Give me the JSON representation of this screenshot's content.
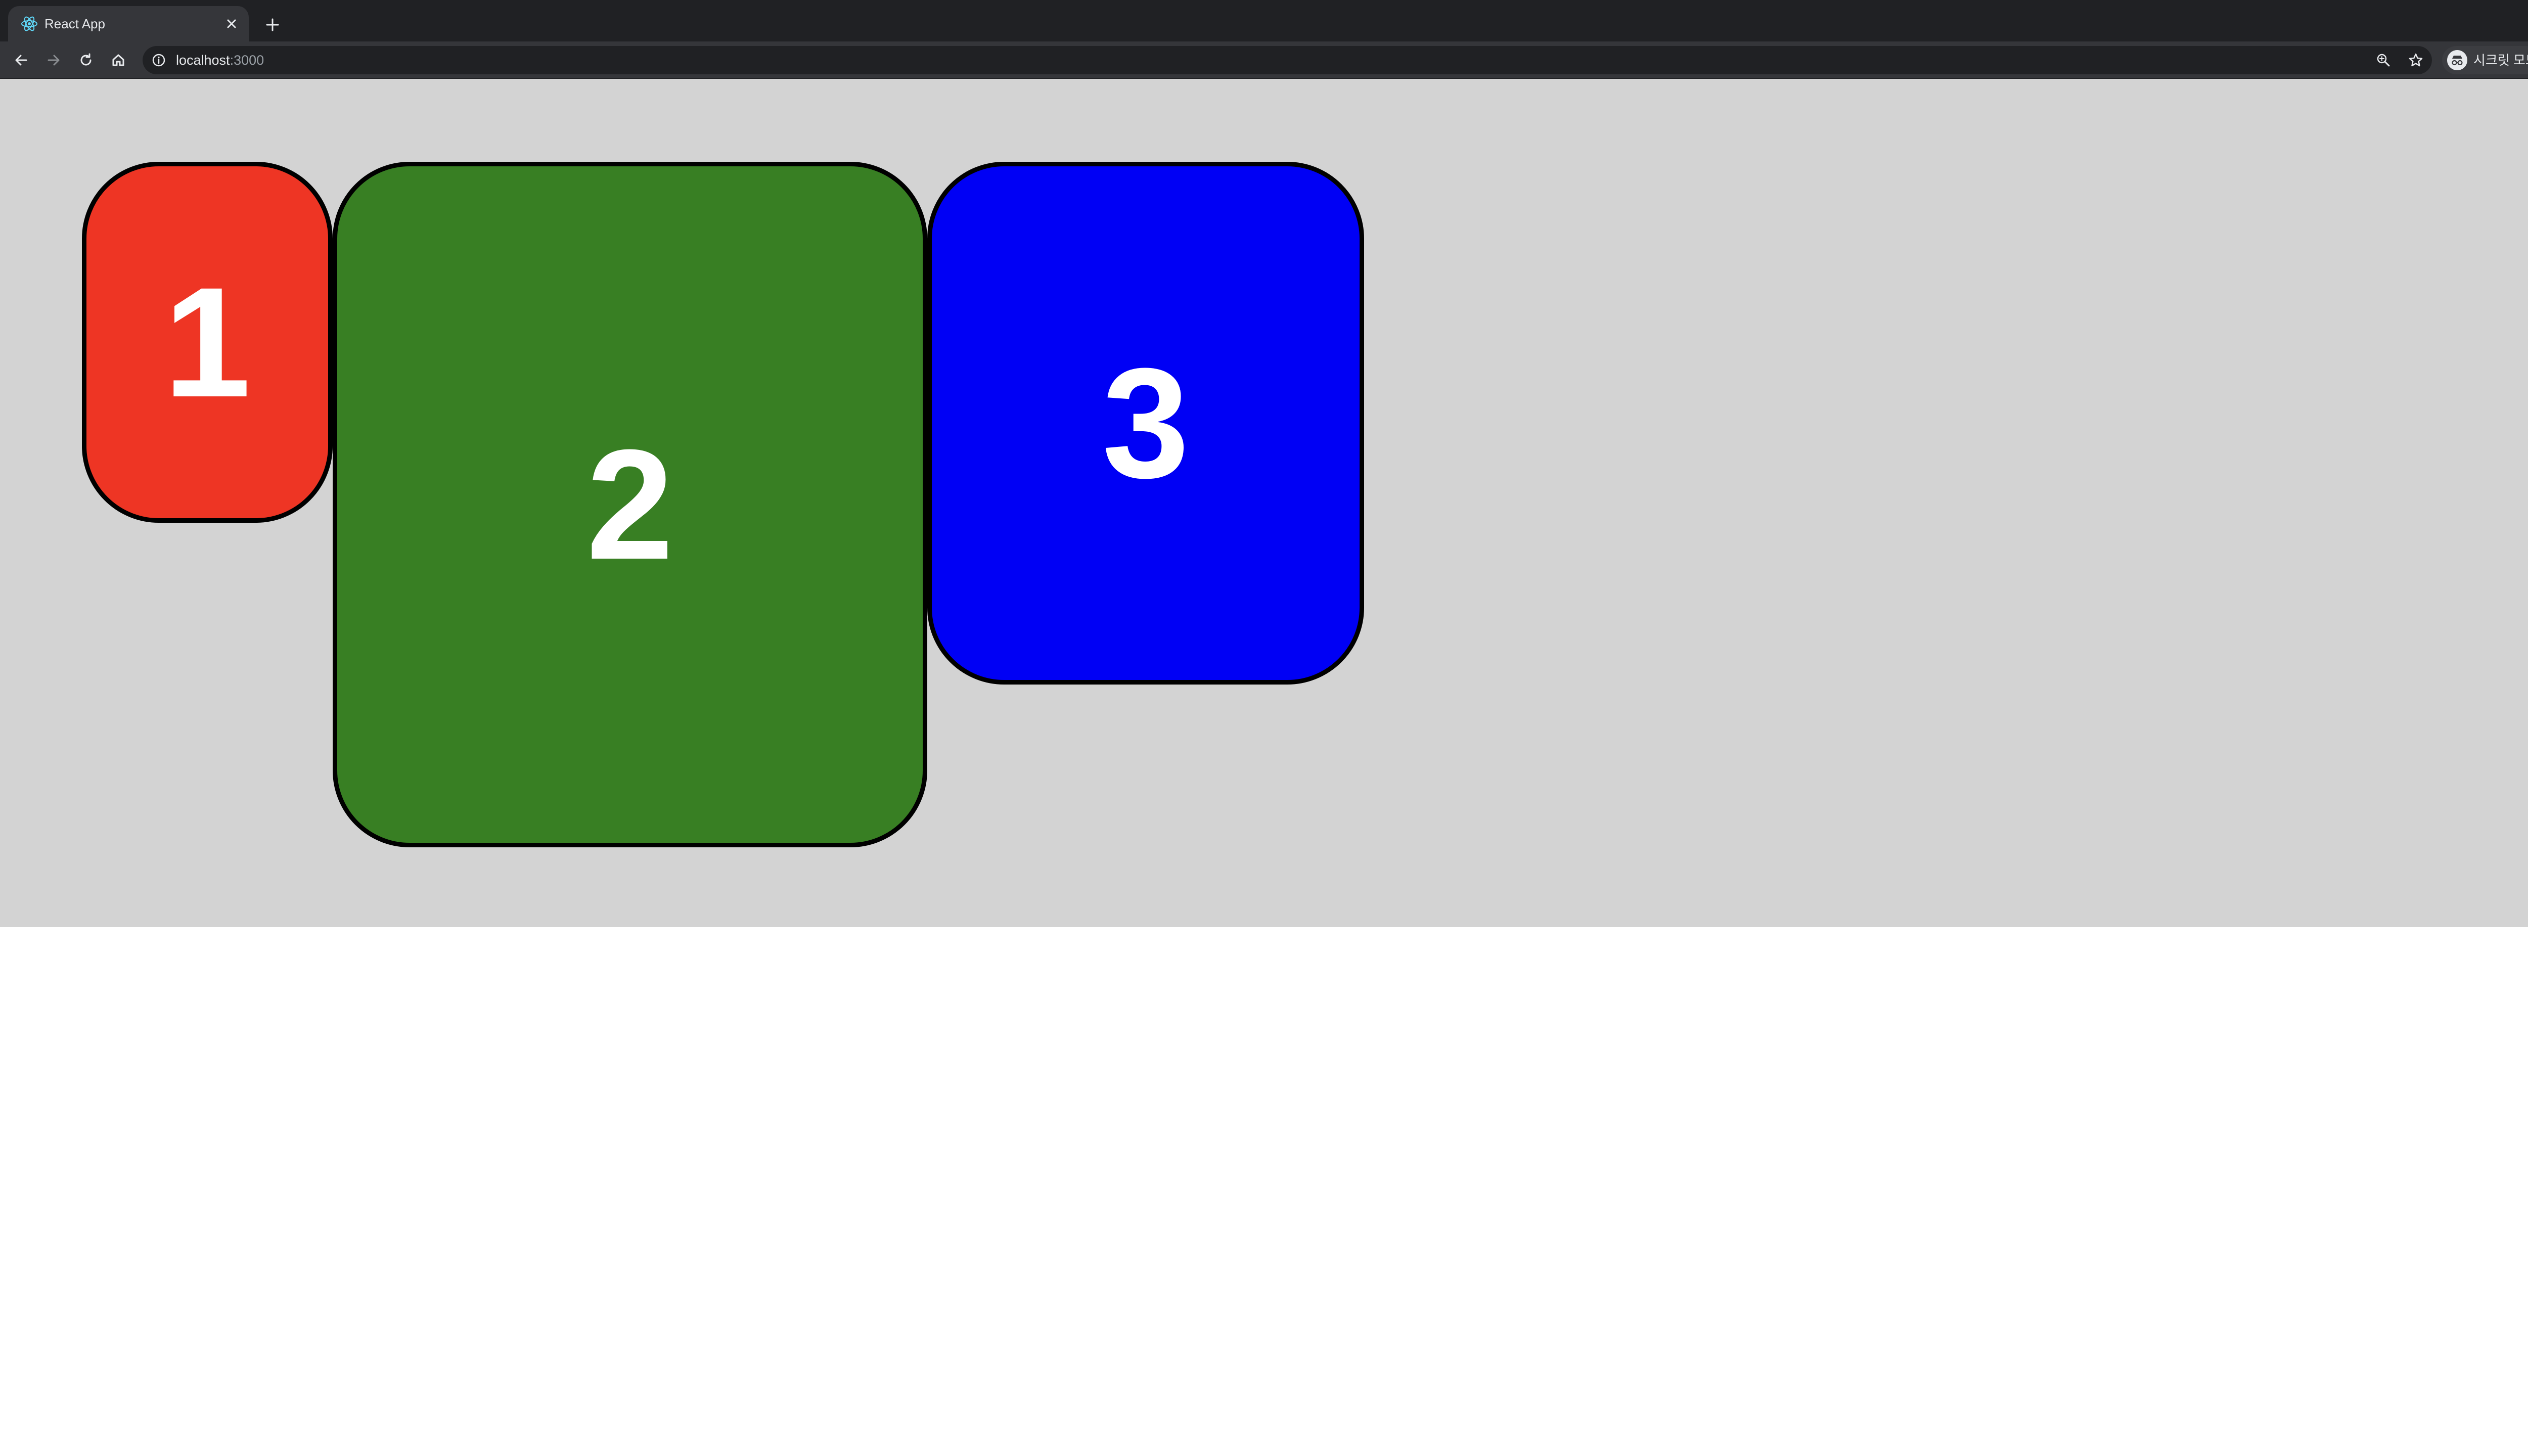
{
  "browser": {
    "tab": {
      "title": "React App",
      "favicon": "react-logo-icon"
    },
    "new_tab_icon": "plus-icon",
    "tab_search_icon": "chevron-down-icon",
    "toolbar": {
      "back_icon": "arrow-left-icon",
      "forward_icon": "arrow-right-icon",
      "reload_icon": "reload-icon",
      "home_icon": "home-icon"
    },
    "address_bar": {
      "host": "localhost",
      "port": ":3000",
      "info_icon": "info-icon",
      "zoom_icon": "zoom-icon",
      "bookmark_icon": "star-icon"
    },
    "profile": {
      "label": "시크릿 모드",
      "icon": "incognito-icon"
    },
    "menu_icon": "kebab-menu-icon"
  },
  "page": {
    "background_color": "#d3d3d3",
    "boxes": [
      {
        "label": "1",
        "color": "#ee3524"
      },
      {
        "label": "2",
        "color": "#387f23"
      },
      {
        "label": "3",
        "color": "#0000f5"
      }
    ]
  }
}
